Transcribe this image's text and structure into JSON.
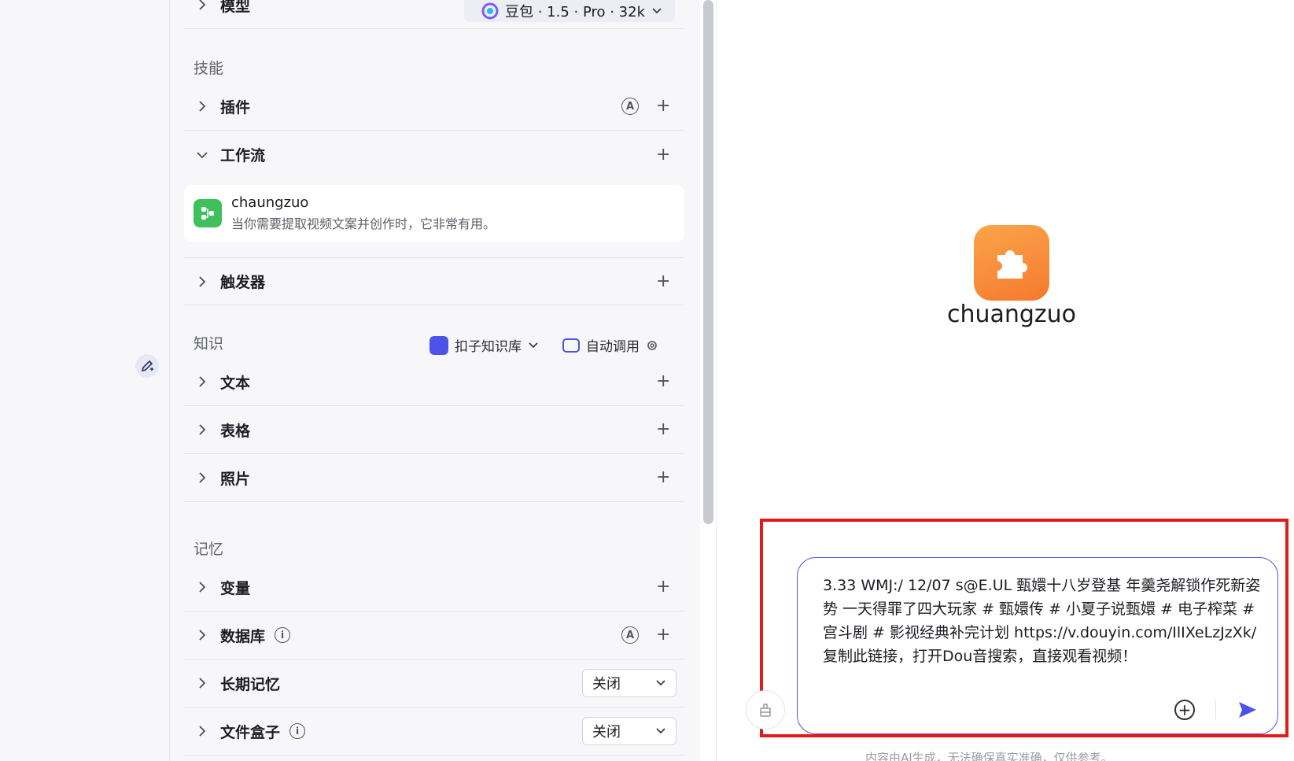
{
  "model": {
    "label": "模型",
    "selected": "豆包 · 1.5 · Pro · 32k"
  },
  "skills": {
    "title": "技能",
    "plugin_label": "插件",
    "workflow_label": "工作流",
    "workflow_item": {
      "name": "chaungzuo",
      "desc": "当你需要提取视频文案并创作时，它非常有用。"
    },
    "trigger_label": "触发器"
  },
  "knowledge": {
    "title": "知识",
    "source": "扣子知识库",
    "mode": "自动调用",
    "text_label": "文本",
    "table_label": "表格",
    "photo_label": "照片"
  },
  "memory": {
    "title": "记忆",
    "variables_label": "变量",
    "database_label": "数据库",
    "longterm_label": "长期记忆",
    "longterm_value": "关闭",
    "filebox_label": "文件盒子",
    "filebox_value": "关闭"
  },
  "badges": {
    "auto": "A",
    "info": "i"
  },
  "preview": {
    "bot_name": "chuangzuo",
    "input_text": "3.33 WMJ:/ 12/07 s@E.UL 甄嬛十八岁登基 年羹尧解锁作死新姿势 一天得罪了四大玩家 # 甄嬛传 # 小夏子说甄嬛 # 电子榨菜 # 宫斗剧 # 影视经典补完计划 https://v.douyin.com/IlIXeLzJzXk/ 复制此链接，打开Dou音搜索，直接观看视频！",
    "disclaimer": "内容由AI生成，无法确保真实准确，仅供参考。"
  },
  "colors": {
    "accent": "#4d53e8",
    "highlight": "#e21a1a",
    "workflow": "#3ec05c",
    "avatar": "#f5792e"
  }
}
